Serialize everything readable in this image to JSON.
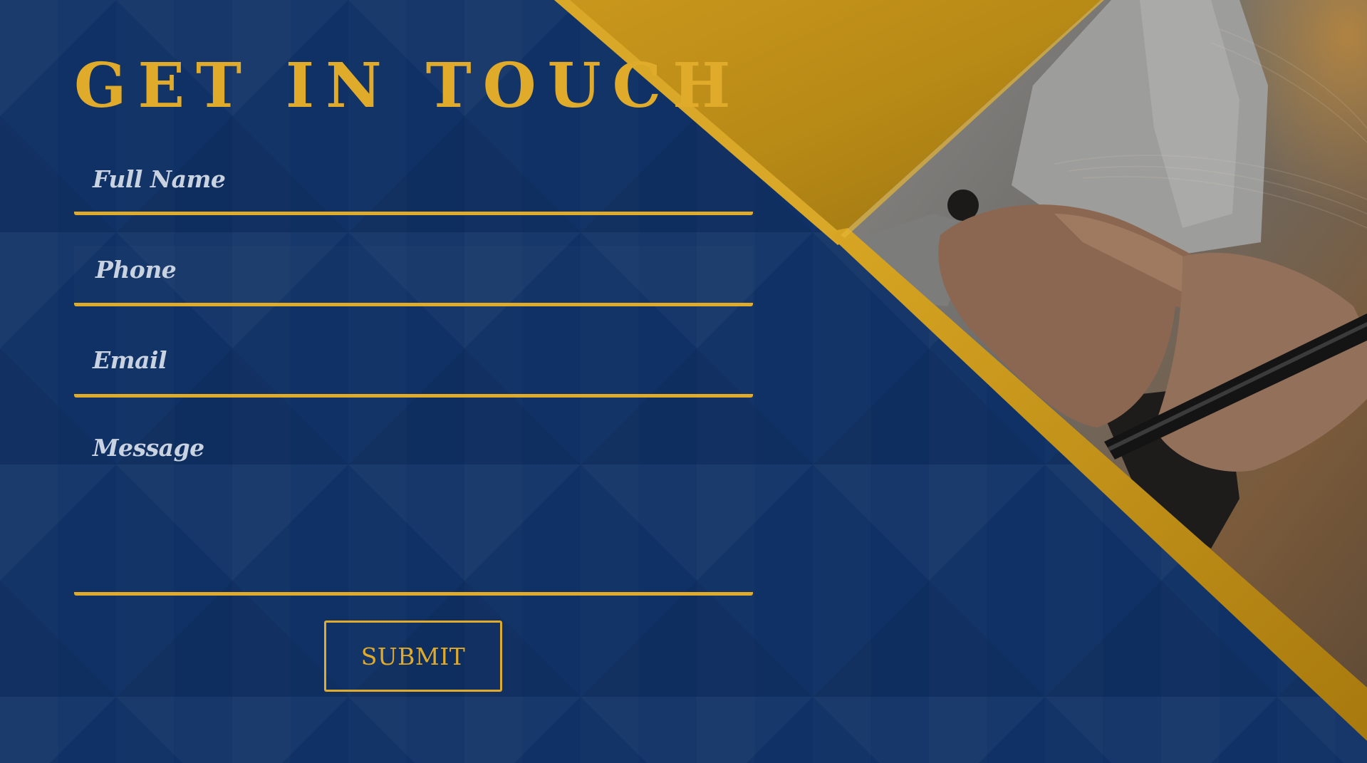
{
  "form": {
    "title": "GET IN TOUCH",
    "fields": {
      "full_name": {
        "placeholder": "Full Name",
        "value": ""
      },
      "phone": {
        "placeholder": "Phone",
        "value": ""
      },
      "email": {
        "placeholder": "Email",
        "value": ""
      },
      "message": {
        "placeholder": "Message",
        "value": ""
      }
    },
    "submit_label": "SUBMIT"
  },
  "colors": {
    "background": "#0f3165",
    "accent_gold": "#e0aa2a",
    "label_text": "#c9d2e0"
  },
  "image": {
    "subject": "person-using-smartphone-photo"
  }
}
